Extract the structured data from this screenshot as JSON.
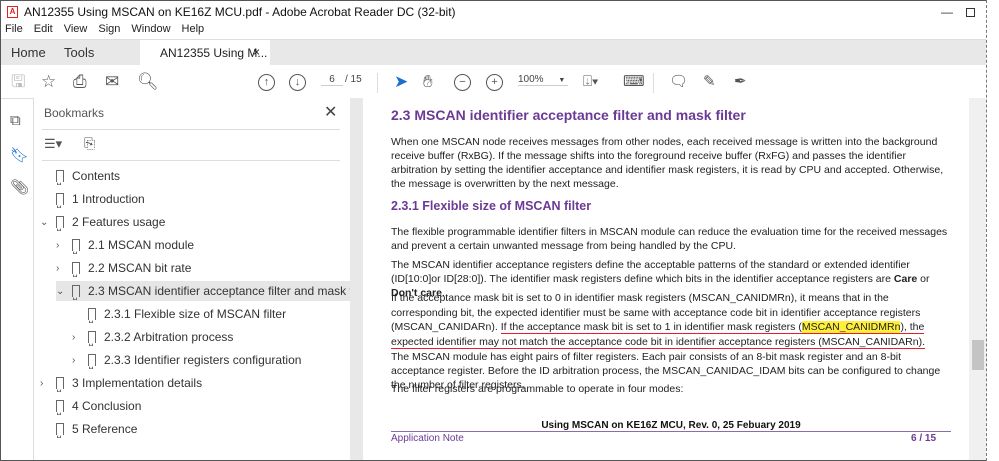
{
  "window": {
    "title": "AN12355 Using MSCAN on KE16Z MCU.pdf - Adobe Acrobat Reader DC (32-bit)",
    "app_icon": "pdf-icon"
  },
  "menu": [
    "File",
    "Edit",
    "View",
    "Sign",
    "Window",
    "Help"
  ],
  "tabs": {
    "home": "Home",
    "tools": "Tools",
    "document": "AN12355 Using M...",
    "close": "×"
  },
  "toolbar": {
    "page_current": "6",
    "page_sep": "/ 15",
    "zoom": "100%"
  },
  "bookmarks": {
    "title": "Bookmarks",
    "close": "✕",
    "items": [
      {
        "label": "Contents",
        "level": 0,
        "chevron": ""
      },
      {
        "label": "1 Introduction",
        "level": 0,
        "chevron": ""
      },
      {
        "label": "2 Features usage",
        "level": 0,
        "chevron": "expanded"
      },
      {
        "label": "2.1 MSCAN module",
        "level": 1,
        "chevron": "collapsed"
      },
      {
        "label": "2.2 MSCAN bit rate",
        "level": 1,
        "chevron": "collapsed"
      },
      {
        "label": "2.3 MSCAN identifier acceptance filter and mask filter",
        "level": 1,
        "chevron": "expanded",
        "selected": true
      },
      {
        "label": "2.3.1 Flexible size of MSCAN filter",
        "level": 2,
        "chevron": ""
      },
      {
        "label": "2.3.2 Arbitration process",
        "level": 2,
        "chevron": "collapsed"
      },
      {
        "label": "2.3.3 Identifier registers configuration",
        "level": 2,
        "chevron": "collapsed"
      },
      {
        "label": "3 Implementation details",
        "level": 0,
        "chevron": "collapsed"
      },
      {
        "label": "4 Conclusion",
        "level": 0,
        "chevron": ""
      },
      {
        "label": "5 Reference",
        "level": 0,
        "chevron": ""
      }
    ]
  },
  "document": {
    "h2": "2.3   MSCAN identifier acceptance filter and mask filter",
    "p1": "When one MSCAN node receives messages from other nodes, each received message is written into the background receive buffer (RxBG). If the message shifts into the foreground receive buffer (RxFG) and passes the identifier arbitration by setting the identifier acceptance and identifier mask registers, it is read by CPU and accepted. Otherwise, the message is overwritten by the next message.",
    "h3": "2.3.1   Flexible size of MSCAN filter",
    "p2": "The flexible programmable identifier filters in MSCAN module can reduce the evaluation time for the received messages and prevent a certain unwanted message from being handled by the CPU.",
    "p3a": "The MSCAN identifier acceptance registers define the acceptable patterns of the standard or extended identifier (ID[10:0]or ID[28:0]). The identifier mask registers define which bits in the identifier acceptance registers are ",
    "p3b": "Care",
    "p3c": " or ",
    "p3d": "Don't care",
    "p3e": ".",
    "p4a": "If the acceptance mask bit is set to 0 in identifier mask registers (MSCAN_CANIDMRn), it means that in the corresponding bit, the expected identifier must be same with acceptance code bit in identifier acceptance registers (MSCAN_CANIDARn). ",
    "p4b": "If the acceptance mask bit is set to 1 in identifier mask registers (",
    "p4c": "MSCAN_CANIDMRn",
    "p4d": "), the expected identifier may not match the acceptance code bit in identifier acceptance registers (MSCAN_CANIDARn).",
    "p5": "The MSCAN module has eight pairs of filter registers. Each pair consists of an 8-bit mask register and an 8-bit acceptance register. Before the ID arbitration process, the MSCAN_CANIDAC_IDAM bits can be configured to change the number of filter registers.",
    "p6": "The filter registers are programmable to operate in four modes:",
    "footer_title": "Using MSCAN on KE16Z MCU, Rev. 0, 25 Febuary 2019",
    "footer_left": "Application Note",
    "footer_right": "6 / 15"
  },
  "colors": {
    "heading": "#6b3a96",
    "highlight": "#ffef3a",
    "underline": "#e0202a",
    "select_tool": "#1a6fd1"
  }
}
